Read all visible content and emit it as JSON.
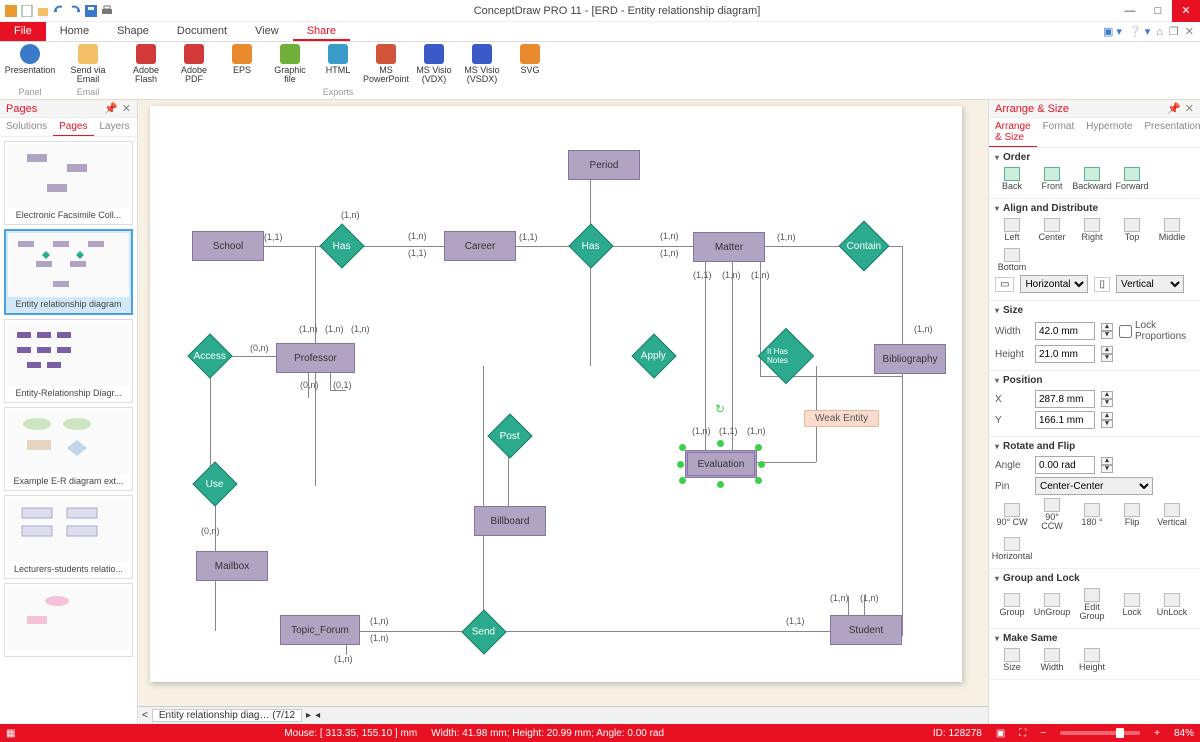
{
  "title": "ConceptDraw PRO 11 - [ERD - Entity relationship diagram]",
  "ribbon_tabs": [
    "File",
    "Home",
    "Shape",
    "Document",
    "View",
    "Share"
  ],
  "ribbon_active": "Share",
  "ribbon_groups": {
    "panel": "Panel",
    "email": "Email",
    "exports": "Exports"
  },
  "ribbon_icons": {
    "presentation": "Presentation",
    "send_email": "Send via Email",
    "flash": "Adobe Flash",
    "pdf": "Adobe PDF",
    "eps": "EPS",
    "graphic": "Graphic file",
    "html": "HTML",
    "ppt": "MS PowerPoint",
    "vdx": "MS Visio (VDX)",
    "vsdx": "MS Visio (VSDX)",
    "svg": "SVG"
  },
  "pages_panel": {
    "title": "Pages",
    "tabs": [
      "Solutions",
      "Pages",
      "Layers"
    ],
    "active": "Pages",
    "thumbs": [
      "Electronic Facsimile Coll...",
      "Entity relationship diagram",
      "Entity-Relationship Diagr...",
      "Example E-R diagram ext...",
      "Lecturers-students relatio..."
    ]
  },
  "arrange_panel": {
    "title": "Arrange & Size",
    "tabs": [
      "Arrange & Size",
      "Format",
      "Hypernote",
      "Presentation"
    ],
    "order": {
      "title": "Order",
      "back": "Back",
      "front": "Front",
      "backward": "Backward",
      "forward": "Forward"
    },
    "align": {
      "title": "Align and Distribute",
      "left": "Left",
      "center": "Center",
      "right": "Right",
      "top": "Top",
      "middle": "Middle",
      "bottom": "Bottom",
      "horizontal": "Horizontal",
      "vertical": "Vertical"
    },
    "size": {
      "title": "Size",
      "width_lbl": "Width",
      "width": "42.0 mm",
      "height_lbl": "Height",
      "height": "21.0 mm",
      "lock": "Lock Proportions"
    },
    "position": {
      "title": "Position",
      "x_lbl": "X",
      "x": "287.8 mm",
      "y_lbl": "Y",
      "y": "166.1 mm"
    },
    "rotate": {
      "title": "Rotate and Flip",
      "angle_lbl": "Angle",
      "angle": "0.00 rad",
      "pin_lbl": "Pin",
      "pin": "Center-Center",
      "cw": "90° CW",
      "ccw": "90° CCW",
      "r180": "180 °",
      "flip": "Flip",
      "vert": "Vertical",
      "horiz": "Horizontal"
    },
    "group": {
      "title": "Group and Lock",
      "group": "Group",
      "ungroup": "UnGroup",
      "edit": "Edit Group",
      "lock": "Lock",
      "unlock": "UnLock"
    },
    "make_same": {
      "title": "Make Same",
      "size": "Size",
      "width": "Width",
      "height": "Height"
    }
  },
  "diagram": {
    "entities": {
      "period": "Period",
      "school": "School",
      "career": "Career",
      "matter": "Matter",
      "bibliography": "Bibliography",
      "professor": "Professor",
      "evaluation": "Evaluation",
      "billboard": "Billboard",
      "mailbox": "Mailbox",
      "topic_forum": "Topic_Forum",
      "student": "Student"
    },
    "relations": {
      "has1": "Has",
      "has2": "Has",
      "contain": "Contain",
      "access": "Access",
      "apply": "Apply",
      "ithasnotes": "It Has Notes",
      "use": "Use",
      "post": "Post",
      "send": "Send"
    },
    "weak_tooltip": "Weak Entity",
    "cards": {
      "c1": "(1,1)",
      "c2": "(1,n)",
      "c3": "(0,n)",
      "c4": "(0,1)"
    }
  },
  "tabstrip": {
    "doc": "Entity relationship diag…",
    "counter": "(7/12"
  },
  "status": {
    "mouse": "Mouse: [ 313.35, 155.10 ] mm",
    "dims": "Width: 41.98 mm;  Height: 20.99 mm;  Angle: 0.00 rad",
    "id": "ID: 128278",
    "zoom": "84%"
  }
}
